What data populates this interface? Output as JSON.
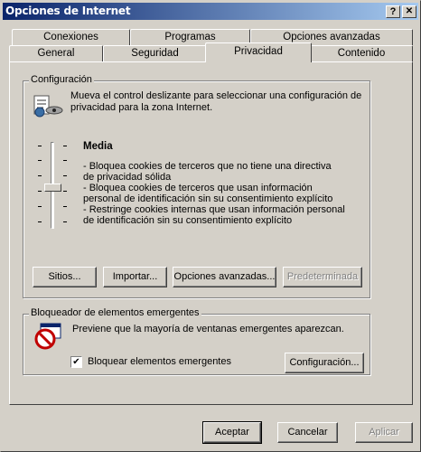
{
  "window": {
    "title": "Opciones de Internet",
    "help_glyph": "?",
    "close_glyph": "✕"
  },
  "tabs": {
    "row_back": [
      "Conexiones",
      "Programas",
      "Opciones avanzadas"
    ],
    "row_front": [
      "General",
      "Seguridad",
      "Privacidad",
      "Contenido"
    ],
    "active": "Privacidad"
  },
  "config": {
    "group_label": "Configuración",
    "intro": [
      "Mueva el control deslizante para seleccionar una configuración de",
      "privacidad para la zona Internet."
    ],
    "level_title": "Media",
    "level_lines": [
      "- Bloquea cookies de terceros que no tiene una directiva",
      "de privacidad sólida",
      "- Bloquea cookies de terceros que usan información",
      "personal de identificación sin su consentimiento explícito",
      "- Restringe cookies internas que usan información personal",
      "de identificación sin su consentimiento explícito"
    ],
    "slider_level": 0.5,
    "buttons": {
      "sites": "Sitios...",
      "import": "Importar...",
      "advanced": "Opciones avanzadas...",
      "default": "Predeterminada"
    }
  },
  "popup": {
    "group_label": "Bloqueador de elementos emergentes",
    "description": "Previene que la mayoría de ventanas emergentes aparezcan.",
    "checkbox_label": "Bloquear elementos emergentes",
    "checkbox_checked": true,
    "check_glyph": "✔",
    "settings_button": "Configuración..."
  },
  "footer": {
    "accept": "Aceptar",
    "cancel": "Cancelar",
    "apply": "Aplicar"
  },
  "colors": {
    "titlebar_start": "#0a246a",
    "titlebar_end": "#a6caf0",
    "face": "#d4d0c8",
    "disabled_text": "#808080"
  }
}
